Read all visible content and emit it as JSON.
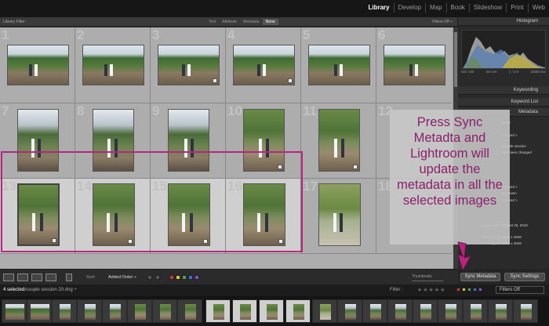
{
  "modules": [
    "Library",
    "Develop",
    "Map",
    "Book",
    "Slideshow",
    "Print",
    "Web"
  ],
  "active_module": "Library",
  "library_filter": {
    "label": "Library Filter :",
    "tabs": [
      "Text",
      "Attribute",
      "Metadata",
      "None"
    ],
    "active_tab": "None",
    "filters_off": "Filters Off ÷"
  },
  "grid": {
    "cell_numbers": [
      "1",
      "2",
      "3",
      "4",
      "5",
      "6",
      "7",
      "8",
      "9",
      "10",
      "11",
      "12",
      "13",
      "14",
      "15",
      "16",
      "17",
      "18"
    ]
  },
  "right_panel": {
    "histogram_label": "Histogram",
    "histogram_info": [
      "ISO 100",
      "26 mm",
      "ƒ / 3.0",
      "1/500 sec"
    ],
    "keywording_label": "Keywording",
    "keyword_list_label": "Keyword List",
    "metadata_label": "Metadata",
    "meta_values": {
      "preset": "None",
      "mixed1": "< mixed >",
      "title_val": "Couple session",
      "status": "Has been changed",
      "mixed2": "< mixed >",
      "unknown": "Unknown",
      "mixed3": "< mixed >"
    },
    "capture_date": {
      "key": "Capture Date",
      "value": "August 25, 2018"
    },
    "dimensions": {
      "key": "Dimensions",
      "value": "3264 x 4928"
    },
    "cropped": {
      "key": "Cropped",
      "value": "3264 x 4928"
    }
  },
  "annotation": {
    "text": "Press Sync Metadta and Lightroom will update the metadata in all the selected images",
    "color": "#8b1f6b"
  },
  "toolbar": {
    "sort_label": "Sort:",
    "sort_value": "Added Order ÷",
    "thumbnails_label": "Thumbnails",
    "sync_metadata": "Sync Metadata",
    "sync_settings": "Sync Settings",
    "color_labels": [
      "#c83a3a",
      "#d9c43a",
      "#4fa34f",
      "#3a6fd0",
      "#8a4fc0"
    ]
  },
  "filmstrip": {
    "selection_info": "4 selected",
    "file_info": "/couple session 20.dng ÷",
    "filter_label": "Filter :",
    "filters_off": "Filters Off"
  }
}
